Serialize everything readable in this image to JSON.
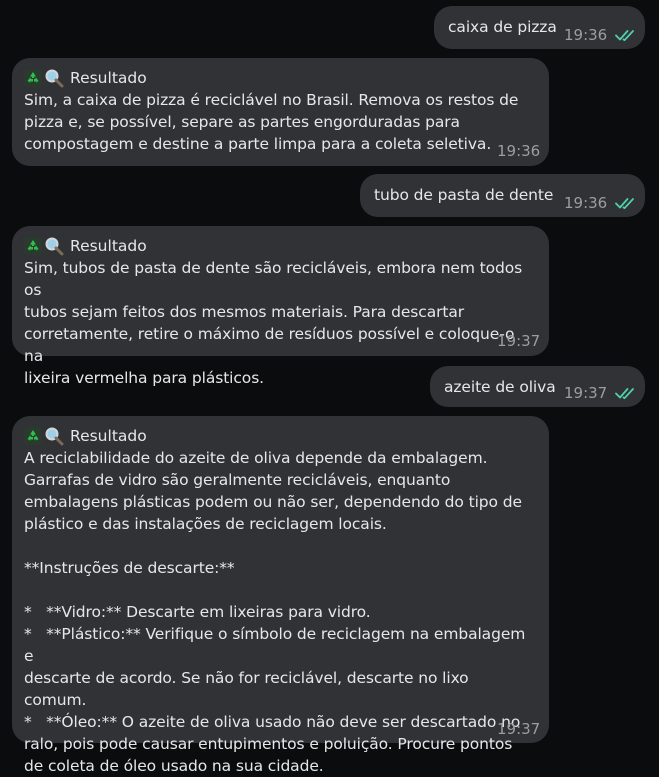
{
  "messages": [
    {
      "direction": "outgoing",
      "text": "caixa de pizza",
      "time": "19:36",
      "status": "read"
    },
    {
      "direction": "incoming",
      "header": "Resultado",
      "text": "Sim, a caixa de pizza é reciclável no Brasil. Remova os restos de\npizza e, se possível, separe as partes engorduradas para\ncompostagem e destine a parte limpa para a coleta seletiva.",
      "time": "19:36"
    },
    {
      "direction": "outgoing",
      "text": "tubo de pasta de dente",
      "time": "19:36",
      "status": "read"
    },
    {
      "direction": "incoming",
      "header": "Resultado",
      "text": "Sim, tubos de pasta de dente são recicláveis, embora nem todos os\ntubos sejam feitos dos mesmos materiais. Para descartar\ncorretamente, retire o máximo de resíduos possível e coloque-o na\nlixeira vermelha para plásticos.",
      "time": "19:37"
    },
    {
      "direction": "outgoing",
      "text": "azeite de oliva",
      "time": "19:37",
      "status": "read"
    },
    {
      "direction": "incoming",
      "header": "Resultado",
      "text": "A reciclabilidade do azeite de oliva depende da embalagem.\nGarrafas de vidro são geralmente recicláveis, enquanto\nembalagens plásticas podem ou não ser, dependendo do tipo de\nplástico e das instalações de reciclagem locais.\n\n**Instruções de descarte:**\n\n*   **Vidro:** Descarte em lixeiras para vidro.\n*   **Plástico:** Verifique o símbolo de reciclagem na embalagem e\ndescarte de acordo. Se não for reciclável, descarte no lixo comum.\n*   **Óleo:** O azeite de oliva usado não deve ser descartado no\nralo, pois pode causar entupimentos e poluição. Procure pontos\nde coleta de óleo usado na sua cidade.",
      "time": "19:37"
    }
  ],
  "colors": {
    "background": "#0b0c0e",
    "bubble": "#303235",
    "text": "#e6e7e8",
    "time": "#9a9ea3",
    "read_check": "#4fd1b0",
    "recycle_green": "#2fbf4a",
    "magnifier": "#cfd8dc"
  },
  "icons": {
    "header_icons": [
      "recycle-icon",
      "magnifier-icon"
    ],
    "read_receipt": "double-check-icon"
  }
}
